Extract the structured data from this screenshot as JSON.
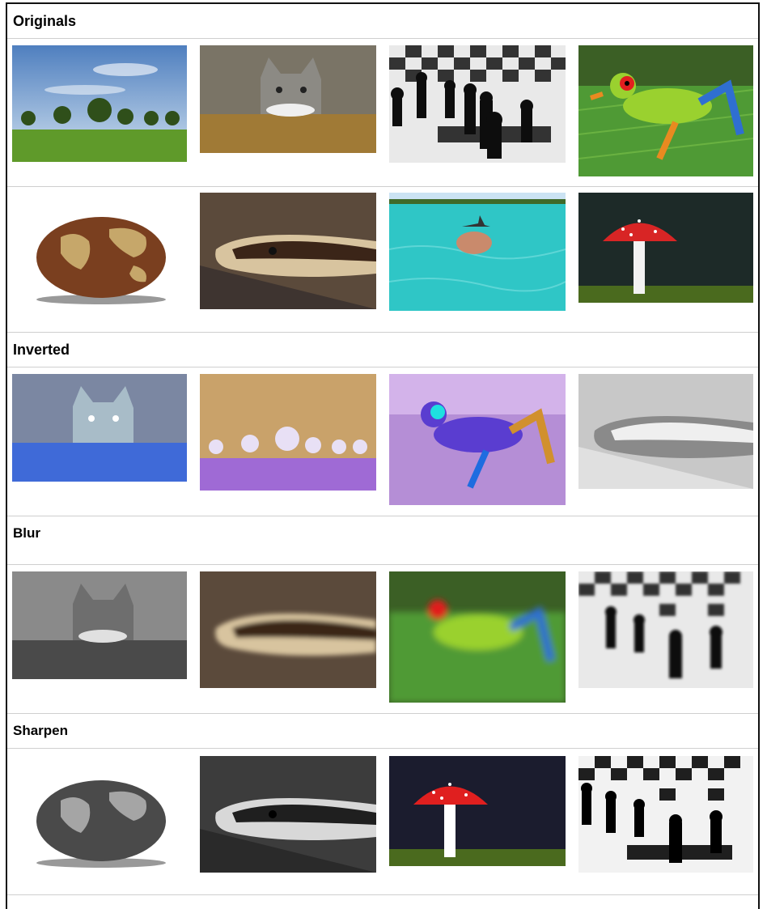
{
  "sections": [
    {
      "title": "Originals"
    },
    {
      "title": "Inverted"
    },
    {
      "title": "Blur"
    },
    {
      "title": "Sharpen"
    }
  ],
  "images": {
    "trees": "landscape with trees",
    "kitten": "kitten peeking",
    "chess": "chess pieces",
    "frog": "red-eyed tree frog",
    "potato": "world-map potato",
    "snake": "python snake",
    "pig": "swimming pig with bird",
    "mushroom": "red toadstool mushroom"
  }
}
